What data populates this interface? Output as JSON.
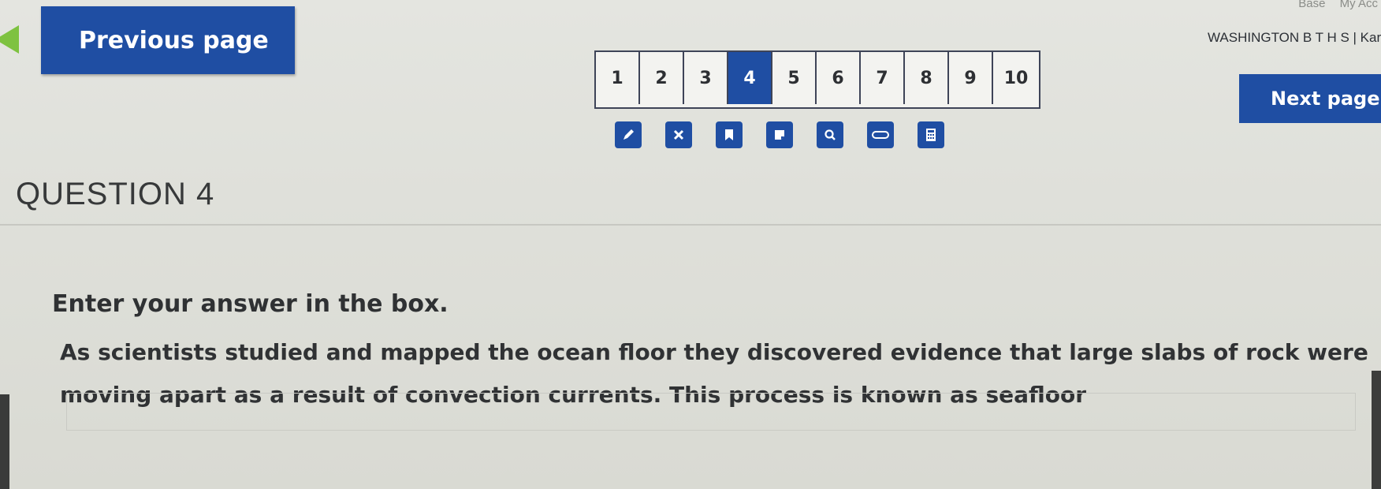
{
  "top_links": {
    "item1": "Base",
    "item2": "My Acc"
  },
  "nav": {
    "previous_label": "Previous page",
    "next_label": "Next page"
  },
  "school_info": "WASHINGTON B T H S | Kary L",
  "pagination": {
    "pages": [
      "1",
      "2",
      "3",
      "4",
      "5",
      "6",
      "7",
      "8",
      "9",
      "10"
    ],
    "current": "4"
  },
  "toolbar": {
    "tools": [
      "pencil-icon",
      "close-icon",
      "bookmark-icon",
      "note-icon",
      "zoom-icon",
      "line-reader-icon",
      "calculator-icon"
    ]
  },
  "question": {
    "heading": "QUESTION 4",
    "prompt": "Enter your answer in the box.",
    "line1": "As scientists studied and mapped the ocean floor they discovered evidence that large slabs of rock were",
    "line2": "moving apart as a result of convection currents. This process is known as seafloor",
    "answer_value": ""
  },
  "colors": {
    "primary": "#1f4ea3",
    "arrow": "#7ec240",
    "background": "#e0e1dc"
  }
}
